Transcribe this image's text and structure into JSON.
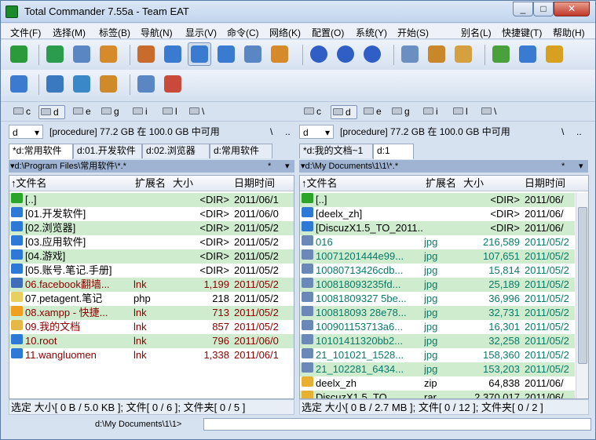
{
  "window": {
    "title": "Total Commander 7.55a - Team EAT",
    "min": "_",
    "max": "□",
    "close": "✕"
  },
  "menu": [
    "文件(F)",
    "选择(M)",
    "标签(B)",
    "导航(N)",
    "显示(V)",
    "命令(C)",
    "网络(K)",
    "配置(O)",
    "系统(Y)",
    "开始(S)",
    "别名(L)",
    "快捷键(T)",
    "帮助(H)"
  ],
  "drives_left": [
    "c",
    "d",
    "e",
    "g",
    "i",
    "l",
    "\\"
  ],
  "drives_right": [
    "c",
    "d",
    "e",
    "g",
    "i",
    "l",
    "\\"
  ],
  "left": {
    "drive": "d",
    "info": "[procedure]  77.2 GB 在 100.0 GB 中可用",
    "root_btn": "\\",
    "up_btn": "..",
    "tabs": [
      "*d:常用软件",
      "d:01.开发软件",
      "d:02.浏览器",
      "d:常用软件"
    ],
    "path": "▾d:\\Program Files\\常用软件\\*.*",
    "star": "*",
    "hdr": {
      "name": "↑文件名",
      "ext": "扩展名",
      "size": "大小",
      "date": "日期时间"
    },
    "rows": [
      {
        "name": "[..]",
        "ext": "",
        "size": "<DIR>",
        "date": "2011/06/1",
        "icon": "up",
        "color": "#000",
        "g": true
      },
      {
        "name": "[01.开发软件]",
        "ext": "",
        "size": "<DIR>",
        "date": "2011/06/0",
        "icon": "folder",
        "color": "#000",
        "g": false
      },
      {
        "name": "[02.浏览器]",
        "ext": "",
        "size": "<DIR>",
        "date": "2011/05/2",
        "icon": "folder",
        "color": "#000",
        "g": true
      },
      {
        "name": "[03.应用软件]",
        "ext": "",
        "size": "<DIR>",
        "date": "2011/05/2",
        "icon": "folder",
        "color": "#000",
        "g": false
      },
      {
        "name": "[04.游戏]",
        "ext": "",
        "size": "<DIR>",
        "date": "2011/05/2",
        "icon": "folder",
        "color": "#000",
        "g": true
      },
      {
        "name": "[05.账号.笔记.手册]",
        "ext": "",
        "size": "<DIR>",
        "date": "2011/05/2",
        "icon": "folder",
        "color": "#000",
        "g": false
      },
      {
        "name": "06.facebook翻墙...",
        "ext": "lnk",
        "size": "1,199",
        "date": "2011/05/2",
        "icon": "web",
        "color": "#8b0000",
        "g": true
      },
      {
        "name": "07.petagent.笔记",
        "ext": "php",
        "size": "218",
        "date": "2011/05/2",
        "icon": "doc",
        "color": "#000",
        "g": false
      },
      {
        "name": "08.xampp - 快捷...",
        "ext": "lnk",
        "size": "713",
        "date": "2011/05/2",
        "icon": "orange",
        "color": "#8b0000",
        "g": true
      },
      {
        "name": "09.我的文档",
        "ext": "lnk",
        "size": "857",
        "date": "2011/05/2",
        "icon": "book",
        "color": "#8b0000",
        "g": false
      },
      {
        "name": "10.root",
        "ext": "lnk",
        "size": "796",
        "date": "2011/06/0",
        "icon": "folder",
        "color": "#8b0000",
        "g": true
      },
      {
        "name": "11.wangluomen",
        "ext": "lnk",
        "size": "1,338",
        "date": "2011/06/1",
        "icon": "folder",
        "color": "#8b0000",
        "g": false
      }
    ],
    "status": "选定  大小[ 0 B / 5.0 KB ]; 文件[ 0 / 6 ]; 文件夹[ 0 / 5 ]"
  },
  "right": {
    "drive": "d",
    "info": "[procedure]  77.2 GB 在 100.0 GB 中可用",
    "root_btn": "\\",
    "up_btn": "..",
    "tabs": [
      "*d:我的文档~1",
      "d:1"
    ],
    "path": "▾d:\\My Documents\\1\\1\\*.*",
    "star": "*",
    "hdr": {
      "name": "↑文件名",
      "ext": "扩展名",
      "size": "大小",
      "date": "日期时间"
    },
    "rows": [
      {
        "name": "[..]",
        "ext": "",
        "size": "<DIR>",
        "date": "2011/06/",
        "icon": "up",
        "color": "#000",
        "g": true
      },
      {
        "name": "[deelx_zh]",
        "ext": "",
        "size": "<DIR>",
        "date": "2011/06/",
        "icon": "folder",
        "color": "#000",
        "g": false
      },
      {
        "name": "[DiscuzX1.5_TO_2011...]",
        "ext": "",
        "size": "<DIR>",
        "date": "2011/06/",
        "icon": "folder",
        "color": "#000",
        "g": true
      },
      {
        "name": "016",
        "ext": "jpg",
        "size": "216,589",
        "date": "2011/05/2",
        "icon": "jpg",
        "color": "#0a7a6a",
        "g": false
      },
      {
        "name": "10071201444e99...",
        "ext": "jpg",
        "size": "107,651",
        "date": "2011/05/2",
        "icon": "jpg",
        "color": "#0a7a6a",
        "g": true
      },
      {
        "name": "10080713426cdb...",
        "ext": "jpg",
        "size": "15,814",
        "date": "2011/05/2",
        "icon": "jpg",
        "color": "#0a7a6a",
        "g": false
      },
      {
        "name": "100818093235fd...",
        "ext": "jpg",
        "size": "25,189",
        "date": "2011/05/2",
        "icon": "jpg",
        "color": "#0a7a6a",
        "g": true
      },
      {
        "name": "10081809327 5be...",
        "ext": "jpg",
        "size": "36,996",
        "date": "2011/05/2",
        "icon": "jpg",
        "color": "#0a7a6a",
        "g": false
      },
      {
        "name": "100818093 28e78...",
        "ext": "jpg",
        "size": "32,731",
        "date": "2011/05/2",
        "icon": "jpg",
        "color": "#0a7a6a",
        "g": true
      },
      {
        "name": "100901153713a6...",
        "ext": "jpg",
        "size": "16,301",
        "date": "2011/05/2",
        "icon": "jpg",
        "color": "#0a7a6a",
        "g": false
      },
      {
        "name": "10101411320bb2...",
        "ext": "jpg",
        "size": "32,258",
        "date": "2011/05/2",
        "icon": "jpg",
        "color": "#0a7a6a",
        "g": true
      },
      {
        "name": "21_101021_1528...",
        "ext": "jpg",
        "size": "158,360",
        "date": "2011/05/2",
        "icon": "jpg",
        "color": "#0a7a6a",
        "g": false
      },
      {
        "name": "21_102281_6434...",
        "ext": "jpg",
        "size": "153,203",
        "date": "2011/05/2",
        "icon": "jpg",
        "color": "#0a7a6a",
        "g": true
      },
      {
        "name": "deelx_zh",
        "ext": "zip",
        "size": "64,838",
        "date": "2011/06/",
        "icon": "zip",
        "color": "#000",
        "g": false
      },
      {
        "name": "DiscuzX1.5_TO_...",
        "ext": "rar",
        "size": "2,370,017",
        "date": "2011/06/",
        "icon": "zip",
        "color": "#000",
        "g": true
      }
    ],
    "status": "选定  大小[ 0 B / 2.7 MB ]; 文件[ 0 / 12 ]; 文件夹[ 0 / 2 ]"
  },
  "cmdline": {
    "path": "d:\\My Documents\\1\\1>"
  },
  "colors": {
    "selected_row": "#cfeccf",
    "path_bar": "#9fb4d2",
    "link_text": "#8b0000",
    "image_text": "#0a7a6a"
  }
}
